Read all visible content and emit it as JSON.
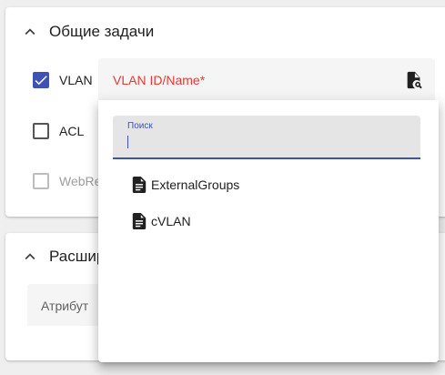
{
  "general": {
    "title": "Общие задачи"
  },
  "checks": [
    {
      "label": "VLAN",
      "state": "checked"
    },
    {
      "label": "ACL",
      "state": "unchecked"
    },
    {
      "label": "WebRe",
      "state": "disabled"
    }
  ],
  "vlan_field": {
    "label": "VLAN ID/Name*",
    "icon": "file-search-icon"
  },
  "dropdown": {
    "search_label": "Поиск",
    "search_value": "",
    "options": [
      {
        "label": "ExternalGroups",
        "icon": "file-document-icon"
      },
      {
        "label": "cVLAN",
        "icon": "file-document-icon"
      }
    ]
  },
  "advanced": {
    "title": "Расшир",
    "attribute_label": "Атрибут"
  },
  "colors": {
    "accent": "#3f51b5",
    "error": "#e53935"
  }
}
